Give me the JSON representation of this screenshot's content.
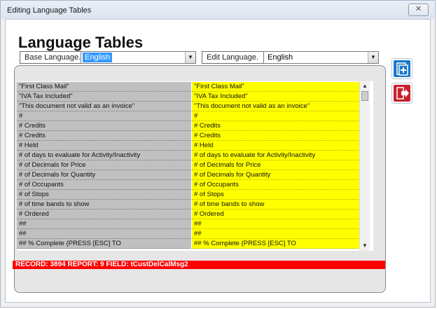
{
  "window": {
    "title": "Editing Language Tables",
    "close_glyph": "✕"
  },
  "page": {
    "title": "Language Tables"
  },
  "base": {
    "label": "Base Language.",
    "value": "English"
  },
  "edit": {
    "label": "Edit Language.",
    "value": "English"
  },
  "rows": [
    {
      "base": "\"First Class Mail\"",
      "edit": "\"First Class Mail\""
    },
    {
      "base": "\"IVA Tax Included\"",
      "edit": "\"IVA Tax Included\""
    },
    {
      "base": "\"This document not valid as an invoice\"",
      "edit": "\"This document not valid as an invoice\""
    },
    {
      "base": "#",
      "edit": "#"
    },
    {
      "base": "# Credits",
      "edit": "# Credits"
    },
    {
      "base": "# Credits",
      "edit": "# Credits"
    },
    {
      "base": "# Held",
      "edit": "# Held"
    },
    {
      "base": "# of days to evaluate for Activity/Inactivity",
      "edit": "# of days to evaluate for Activity/Inactivity"
    },
    {
      "base": "# of Decimals for Price",
      "edit": "# of Decimals for Price"
    },
    {
      "base": "# of Decimals for Quantity",
      "edit": "# of Decimals for Quantity"
    },
    {
      "base": "# of Occupants",
      "edit": "# of Occupants"
    },
    {
      "base": "# of Stops",
      "edit": "# of Stops"
    },
    {
      "base": "# of time bands to show",
      "edit": "# of time bands to show"
    },
    {
      "base": "# Ordered",
      "edit": "# Ordered"
    },
    {
      "base": "##",
      "edit": "##"
    },
    {
      "base": "##",
      "edit": "##"
    },
    {
      "base": "## % Complete    (PRESS [ESC] TO",
      "edit": "## % Complete    (PRESS [ESC] TO"
    }
  ],
  "status": {
    "text": "RECORD: 3894    REPORT: 9    FIELD: tCustDelCalMsg2"
  },
  "icons": {
    "add": "add-icon",
    "exit": "exit-icon"
  },
  "colors": {
    "accent": "#3399ff",
    "base_cell": "#c0c0c0",
    "edit_cell": "#ffff00",
    "status_bar": "#ff0000",
    "side_button": "#1a77c9",
    "exit_button": "#c9202b"
  }
}
